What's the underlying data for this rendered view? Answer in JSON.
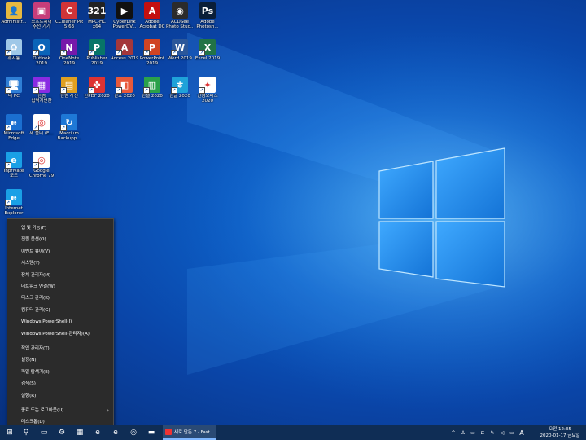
{
  "desktop": {
    "icons": [
      {
        "id": "admin",
        "label": "Administr...",
        "glyph": "👤",
        "color": "#e6b840",
        "icon": "user-folder-icon"
      },
      {
        "id": "sw",
        "label": "소프트웨어\n추천 기기",
        "glyph": "▣",
        "color": "#c63d7a",
        "icon": "tv-icon"
      },
      {
        "id": "ccleaner",
        "label": "CCleaner Pro\n5.63",
        "glyph": "C",
        "color": "#d13438",
        "icon": "ccleaner-icon"
      },
      {
        "id": "mpchc",
        "label": "MPC-HC\nx64",
        "glyph": "321",
        "color": "#222",
        "icon": "mpchc-icon"
      },
      {
        "id": "power",
        "label": "CyberLink\nPowerDV...",
        "glyph": "▶",
        "color": "#111",
        "icon": "powerdvd-icon"
      },
      {
        "id": "acrobat",
        "label": "Adobe\nAcrobat DC",
        "glyph": "A",
        "color": "#c41010",
        "icon": "acrobat-icon"
      },
      {
        "id": "acdsee",
        "label": "ACDSee\nPhoto Stud...",
        "glyph": "◉",
        "color": "#2b2b2b",
        "icon": "acdsee-icon"
      },
      {
        "id": "ps",
        "label": "Adobe\nPhotosh...",
        "glyph": "Ps",
        "color": "#0a1e38",
        "icon": "photoshop-icon"
      },
      {
        "id": "trash",
        "label": "휴지통",
        "glyph": "♻",
        "color": "#9fc8e8",
        "icon": "recycle-bin-icon"
      },
      {
        "id": "outlook",
        "label": "Outlook\n2019",
        "glyph": "O",
        "color": "#0a64b8",
        "icon": "outlook-icon"
      },
      {
        "id": "onenote",
        "label": "OneNote\n2019",
        "glyph": "N",
        "color": "#7719aa",
        "icon": "onenote-icon"
      },
      {
        "id": "publisher",
        "label": "Publisher\n2019",
        "glyph": "P",
        "color": "#077568",
        "icon": "publisher-icon"
      },
      {
        "id": "access",
        "label": "Access 2019",
        "glyph": "A",
        "color": "#a4373a",
        "icon": "access-icon"
      },
      {
        "id": "powerpoint",
        "label": "PowerPoint\n2019",
        "glyph": "P",
        "color": "#d04423",
        "icon": "powerpoint-icon"
      },
      {
        "id": "word",
        "label": "Word 2019",
        "glyph": "W",
        "color": "#2b579a",
        "icon": "word-icon"
      },
      {
        "id": "excel",
        "label": "Excel 2019",
        "glyph": "X",
        "color": "#217346",
        "icon": "excel-icon"
      },
      {
        "id": "pc",
        "label": "내 PC",
        "glyph": "🖥",
        "color": "#2f7fd6",
        "icon": "computer-icon"
      },
      {
        "id": "calc",
        "label": "한컴\n입력기변환",
        "glyph": "▦",
        "color": "#8a2be2",
        "icon": "keyboard-icon"
      },
      {
        "id": "hwp",
        "label": "한컴 사전",
        "glyph": "▤",
        "color": "#e0a020",
        "icon": "dictionary-icon"
      },
      {
        "id": "hpdf",
        "label": "한PDF 2020",
        "glyph": "✤",
        "color": "#d33",
        "icon": "hpdf-icon"
      },
      {
        "id": "show",
        "label": "한쇼 2020",
        "glyph": "◧",
        "color": "#e8593a",
        "icon": "hanshow-icon"
      },
      {
        "id": "cell",
        "label": "한셀 2020",
        "glyph": "▥",
        "color": "#2aa14a",
        "icon": "hancell-icon"
      },
      {
        "id": "hwp2020",
        "label": "한글 2020",
        "glyph": "ㅎ",
        "color": "#1fa2d9",
        "icon": "hangul-icon"
      },
      {
        "id": "hoffice",
        "label": "한컴오피스\n2020",
        "glyph": "✦",
        "color": "#fff",
        "icon": "hancom-office-icon"
      },
      {
        "id": "edge",
        "label": "Microsoft\nEdge",
        "glyph": "e",
        "color": "#1b6fd0",
        "icon": "edge-icon"
      },
      {
        "id": "ch1",
        "label": "새 폴더 (E...",
        "glyph": "◎",
        "color": "#ffffff",
        "icon": "chrome-icon"
      },
      {
        "id": "backup",
        "label": "Macrium\nBackupp...",
        "glyph": "↻",
        "color": "#1e78d6",
        "icon": "backup-icon"
      },
      {
        "id": "ie1",
        "label": "Inprivate\n모드",
        "glyph": "e",
        "color": "#1aa0e6",
        "icon": "internet-explorer-icon"
      },
      {
        "id": "ch2",
        "label": "Google\nChrome 79",
        "glyph": "◎",
        "color": "#ffffff",
        "icon": "chrome-icon"
      },
      {
        "id": "ie2",
        "label": "Internet\nExplorer",
        "glyph": "e",
        "color": "#1aa0e6",
        "icon": "internet-explorer-icon"
      }
    ]
  },
  "context_menu": {
    "group1": [
      "앱 및 기능(F)",
      "전원 옵션(O)",
      "이벤트 뷰어(V)",
      "시스템(Y)",
      "장치 관리자(M)",
      "네트워크 연결(W)",
      "디스크 관리(K)",
      "컴퓨터 관리(G)",
      "Windows PowerShell(I)",
      "Windows PowerShell(관리자)(A)"
    ],
    "group2": [
      "작업 관리자(T)",
      "설정(N)",
      "파일 탐색기(E)",
      "검색(S)",
      "실행(R)"
    ],
    "group3": [
      "종료 또는 로그아웃(U)",
      "데스크톱(D)"
    ],
    "submenu_arrow": "›"
  },
  "taskbar": {
    "start_glyph": "⊞",
    "search_glyph": "⚲",
    "pinned": [
      {
        "name": "task-view",
        "glyph": "▭"
      },
      {
        "name": "settings",
        "glyph": "⚙"
      },
      {
        "name": "store",
        "glyph": "▦"
      },
      {
        "name": "edge",
        "glyph": "e"
      },
      {
        "name": "ie",
        "glyph": "e"
      },
      {
        "name": "chrome",
        "glyph": "◎"
      },
      {
        "name": "explorer",
        "glyph": "▬"
      }
    ],
    "active_task": "새로 만든 7 - Fast...",
    "tray": {
      "chevron": "^",
      "ime": "A"
    },
    "clock_time": "오전 12:35",
    "clock_date": "2020-01-17 금요일"
  }
}
